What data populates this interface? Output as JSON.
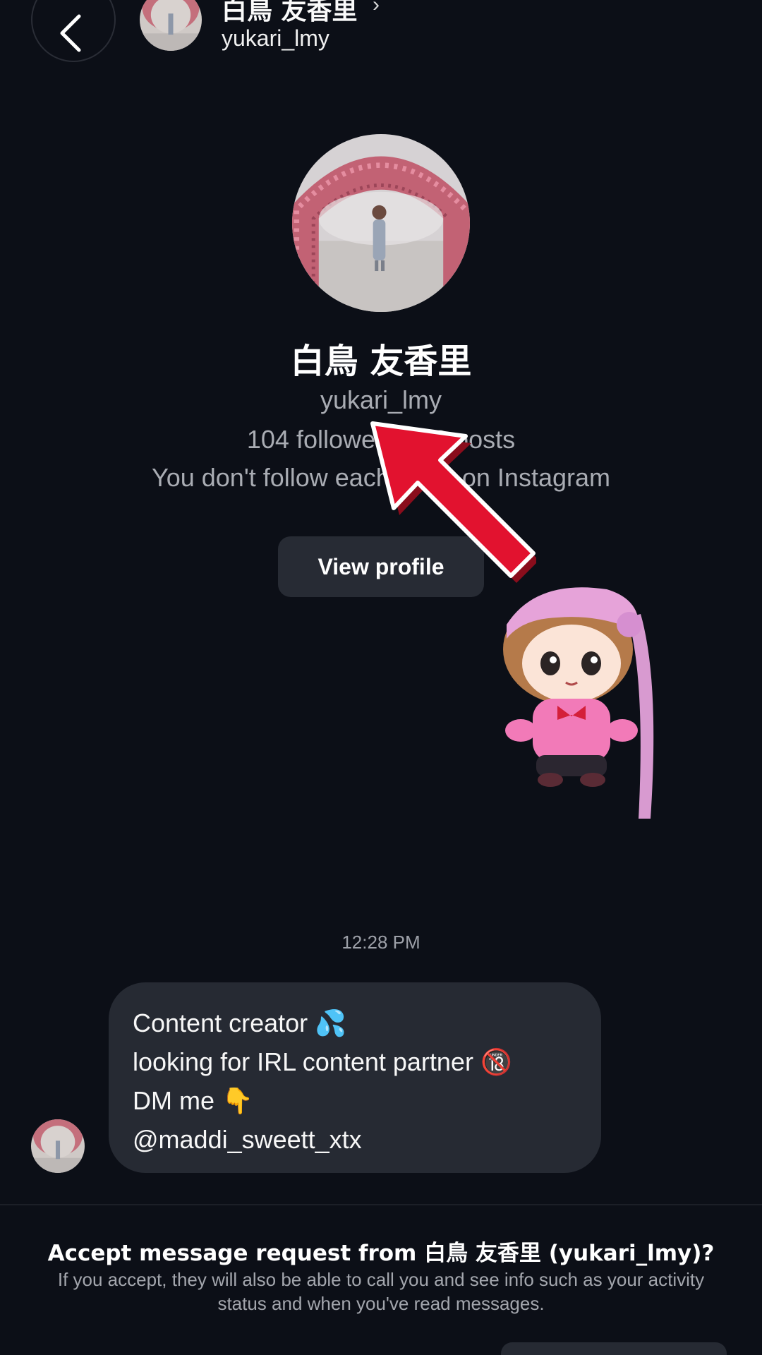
{
  "header": {
    "name": "白鳥 友香里",
    "chevron": "›",
    "username": "yukari_lmy",
    "icons": {
      "back": "chevron-left-icon",
      "detail": "chevron-right-icon"
    }
  },
  "profile": {
    "name": "白鳥 友香里",
    "username": "yukari_lmy",
    "stats": "104 followers · 48 posts",
    "follow_note": "You don't follow each other on Instagram",
    "view_profile_label": "View profile"
  },
  "overlay": {
    "arrow_color": "#e2122f",
    "sticker": "plush-doll-sticker"
  },
  "thread": {
    "timestamp": "12:28 PM",
    "message_lines": [
      "Content creator 💦",
      "looking for IRL content partner 🔞",
      "DM me 👇",
      "@maddi_sweett_xtx"
    ]
  },
  "request": {
    "title": "Accept message request from 白鳥 友香里 (yukari_lmy)?",
    "description": "If you accept, they will also be able to call you and see info such as your activity status and when you've read messages."
  },
  "colors": {
    "background": "#0c0f17",
    "bubble": "#262a33",
    "button": "#272b34",
    "muted_text": "#a9acb3"
  }
}
